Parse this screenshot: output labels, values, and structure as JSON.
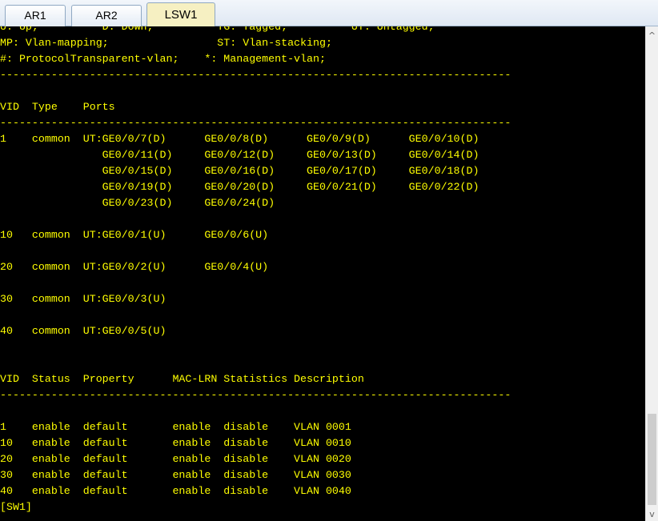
{
  "tabs": [
    {
      "label": "AR1"
    },
    {
      "label": "AR2"
    },
    {
      "label": "LSW1"
    }
  ],
  "active_tab": "LSW1",
  "terminal": {
    "lines": [
      "U: Up;          D: Down;          TG: Tagged;          UT: Untagged;",
      "MP: Vlan-mapping;                 ST: Vlan-stacking;",
      "#: ProtocolTransparent-vlan;    *: Management-vlan;",
      "--------------------------------------------------------------------------------",
      "",
      "VID  Type    Ports",
      "--------------------------------------------------------------------------------",
      "1    common  UT:GE0/0/7(D)      GE0/0/8(D)      GE0/0/9(D)      GE0/0/10(D)",
      "                GE0/0/11(D)     GE0/0/12(D)     GE0/0/13(D)     GE0/0/14(D)",
      "                GE0/0/15(D)     GE0/0/16(D)     GE0/0/17(D)     GE0/0/18(D)",
      "                GE0/0/19(D)     GE0/0/20(D)     GE0/0/21(D)     GE0/0/22(D)",
      "                GE0/0/23(D)     GE0/0/24(D)",
      "",
      "10   common  UT:GE0/0/1(U)      GE0/0/6(U)",
      "",
      "20   common  UT:GE0/0/2(U)      GE0/0/4(U)",
      "",
      "30   common  UT:GE0/0/3(U)",
      "",
      "40   common  UT:GE0/0/5(U)",
      "",
      "",
      "VID  Status  Property      MAC-LRN Statistics Description",
      "--------------------------------------------------------------------------------",
      "",
      "1    enable  default       enable  disable    VLAN 0001",
      "10   enable  default       enable  disable    VLAN 0010",
      "20   enable  default       enable  disable    VLAN 0020",
      "30   enable  default       enable  disable    VLAN 0030",
      "40   enable  default       enable  disable    VLAN 0040",
      "[SW1]"
    ]
  },
  "scrollbar": {
    "up_icon": "^",
    "down_icon": "v"
  },
  "colors": {
    "terminal_bg": "#000000",
    "terminal_text": "#ffff00",
    "active_tab_bg": "#f6f0c2"
  }
}
